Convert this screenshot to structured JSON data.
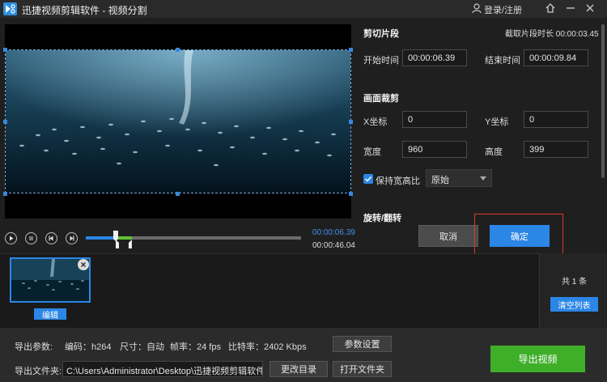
{
  "window": {
    "title": "迅捷视频剪辑软件 - 视频分割",
    "login_label": "登录/注册",
    "icons": [
      "app-logo-icon",
      "user-icon",
      "home-icon",
      "minimize-icon",
      "close-icon"
    ]
  },
  "clip_segment": {
    "title": "剪切片段",
    "duration_label": "截取片段时长 00:00:03.45",
    "start_label": "开始时间",
    "start_value": "00:00:06.39",
    "end_label": "结束时间",
    "end_value": "00:00:09.84"
  },
  "crop": {
    "title": "画面裁剪",
    "x_label": "X坐标",
    "x_value": "0",
    "y_label": "Y坐标",
    "y_value": "0",
    "width_label": "宽度",
    "width_value": "960",
    "height_label": "高度",
    "height_value": "399",
    "keep_ratio_label": "保持宽高比",
    "keep_ratio_checked": true,
    "ratio_selected": "原始"
  },
  "rotate": {
    "title": "旋转/翻转"
  },
  "dialog": {
    "cancel_label": "取消",
    "confirm_label": "确定"
  },
  "playback": {
    "current_time": "00:00:06.39",
    "total_time": "00:00:46.04",
    "progress_fraction": 0.139,
    "selection_start_fraction": 0.139,
    "selection_end_fraction": 0.214
  },
  "clips": {
    "items": [
      {
        "edit_label": "编辑"
      }
    ],
    "count_label": "共 1 条",
    "clear_label": "清空列表"
  },
  "export": {
    "params_label": "导出参数:",
    "codec": "编码：h264",
    "size": "尺寸：自动",
    "fps": "帧率：24 fps",
    "bitrate": "比特率：2402 Kbps",
    "settings_label": "参数设置",
    "folder_label": "导出文件夹:",
    "folder_path": "C:\\Users\\Administrator\\Desktop\\迅捷视频剪辑软件\\",
    "change_dir_label": "更改目录",
    "open_folder_label": "打开文件夹",
    "export_label": "导出视频"
  },
  "colors": {
    "accent": "#2b86e6",
    "export_green": "#3fae29",
    "highlight_red": "#d93a2a",
    "selection_green": "#5cc13a"
  }
}
